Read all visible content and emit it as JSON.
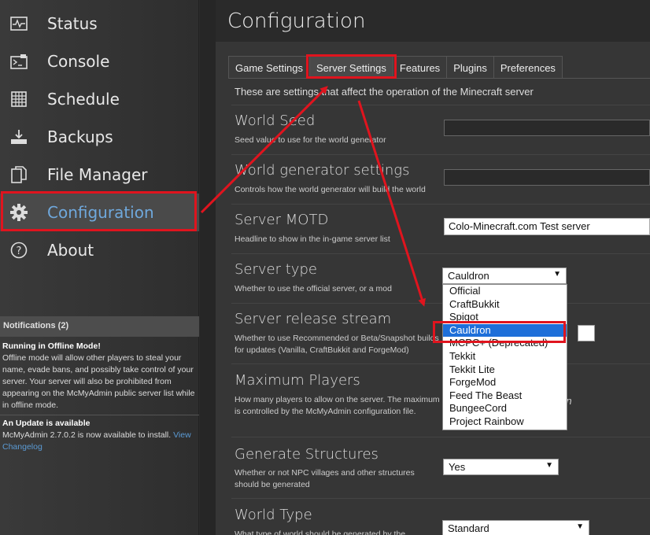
{
  "sidebar": {
    "items": [
      {
        "label": "Status",
        "icon": "status-monitor-icon"
      },
      {
        "label": "Console",
        "icon": "console-icon"
      },
      {
        "label": "Schedule",
        "icon": "schedule-icon"
      },
      {
        "label": "Backups",
        "icon": "backups-download-icon"
      },
      {
        "label": "File Manager",
        "icon": "file-manager-icon"
      },
      {
        "label": "Configuration",
        "icon": "gear-icon"
      },
      {
        "label": "About",
        "icon": "help-circle-icon"
      }
    ],
    "active": "Configuration"
  },
  "notifications": {
    "header": "Notifications (2)",
    "items": [
      {
        "title": "Running in Offline Mode!",
        "body": "Offline mode will allow other players to steal your name, evade bans, and possibly take control of your server. Your server will also be prohibited from appearing on the McMyAdmin public server list while in offline mode."
      },
      {
        "title": "An Update is available",
        "body": "McMyAdmin 2.7.0.2 is now available to install.",
        "link": "View Changelog"
      }
    ]
  },
  "main": {
    "title": "Configuration",
    "tabs": [
      "Game Settings",
      "Server Settings",
      "Features",
      "Plugins",
      "Preferences"
    ],
    "active_tab": "Server Settings",
    "intro": "These are settings that affect the operation of the Minecraft server",
    "settings": [
      {
        "title": "World Seed",
        "desc": "Seed value to use for the world generator",
        "value": ""
      },
      {
        "title": "World generator settings",
        "desc": "Controls how the world generator will build the world",
        "value": ""
      },
      {
        "title": "Server MOTD",
        "desc": "Headline to show in the in-game server list",
        "value": "Colo-Minecraft.com Test server"
      },
      {
        "title": "Server type",
        "desc": "Whether to use the official server, or a mod",
        "value": "Cauldron"
      },
      {
        "title": "Server release stream",
        "desc": "Whether to use Recommended or Beta/Snapshot builds for updates (Vanilla, CraftBukkit and ForgeMod)"
      },
      {
        "title": "Maximum Players",
        "desc": "How many players to allow on the server. The maximum is controlled by the McMyAdmin configuration file.",
        "trailing": "rs in"
      },
      {
        "title": "Generate Structures",
        "desc": "Whether or not NPC villages and other structures should be generated",
        "value": "Yes"
      },
      {
        "title": "World Type",
        "desc": "What type of world should be generated by the",
        "value": "Standard"
      }
    ],
    "server_type_options": [
      "Official",
      "CraftBukkit",
      "Spigot",
      "Cauldron",
      "MCPC+ (Deprecated)",
      "Tekkit",
      "Tekkit Lite",
      "ForgeMod",
      "Feed The Beast",
      "BungeeCord",
      "Project Rainbow"
    ],
    "server_type_selected": "Cauldron"
  },
  "colors": {
    "annotation": "#e0141e",
    "accent": "#6fa8dc",
    "selected": "#1e6fd9"
  }
}
